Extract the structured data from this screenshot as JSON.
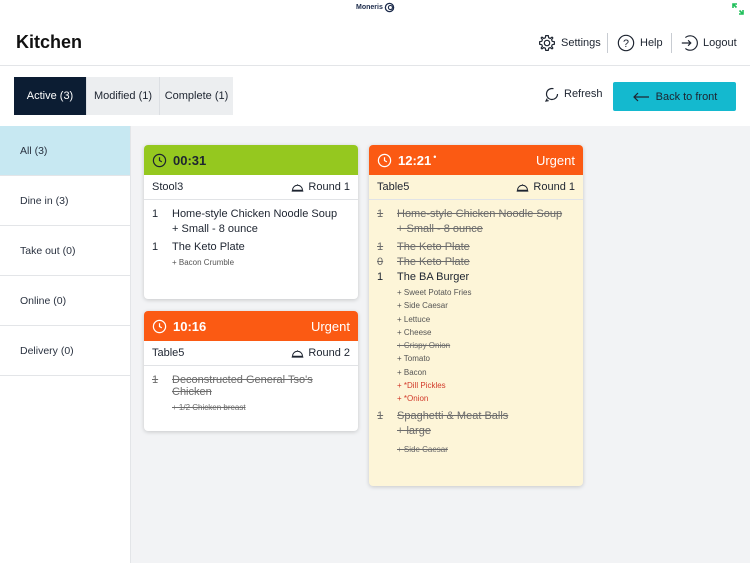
{
  "statusbar": {
    "brand": "Moneris"
  },
  "header": {
    "title": "Kitchen",
    "settings": "Settings",
    "help": "Help",
    "logout": "Logout"
  },
  "toolbar": {
    "tabs": [
      {
        "label": "Active (3)",
        "active": true
      },
      {
        "label": "Modified (1)",
        "active": false
      },
      {
        "label": "Complete (1)",
        "active": false
      }
    ],
    "refresh": "Refresh",
    "back": "Back to front"
  },
  "sidebar": {
    "items": [
      {
        "label": "All (3)",
        "active": true
      },
      {
        "label": "Dine in (3)"
      },
      {
        "label": "Take out (0)"
      },
      {
        "label": "Online (0)"
      },
      {
        "label": "Delivery (0)"
      }
    ]
  },
  "orders": [
    {
      "time": "00:31",
      "color": "#95c81f",
      "table": "Stool3",
      "round": "Round 1",
      "items": [
        {
          "qty": "1",
          "name": "Home-style Chicken Noodle Soup",
          "big_mod": "+ Small - 8 ounce"
        },
        {
          "qty": "1",
          "name": "The Keto Plate",
          "mods": [
            "+ Bacon Crumble"
          ]
        }
      ]
    },
    {
      "time": "10:16",
      "color": "#fb5a13",
      "urgent": "Urgent",
      "table": "Table5",
      "round": "Round 2",
      "items": [
        {
          "qty": "1",
          "name": "Deconstructed General Tso's Chicken",
          "mods": [
            "+ 1/2 Chicken breast"
          ],
          "struck": true
        }
      ]
    },
    {
      "time": "12:21",
      "dot": "•",
      "color": "#fb5a13",
      "urgent": "Urgent",
      "table": "Table5",
      "round": "Round 1",
      "items": [
        {
          "qty": "1",
          "name": "Home-style Chicken Noodle Soup",
          "big_mod": "+ Small - 8 ounce",
          "struck": true
        },
        {
          "qty": "1",
          "name": "The Keto Plate",
          "struck": true
        },
        {
          "qty": "0",
          "name": "The Keto Plate",
          "struck": true
        },
        {
          "qty": "1",
          "name": "The BA Burger",
          "mods": [
            "+ Sweet Potato Fries",
            "+ Side Caesar",
            "+ Lettuce",
            "+ Cheese",
            "+ Crispy Onion",
            "+ Tomato",
            "+ Bacon",
            "+ *Dill Pickles",
            "+ *Onion"
          ]
        },
        {
          "qty": "1",
          "name": "Spaghetti & Meat Balls",
          "big_mod": "+ large",
          "mods": [
            "+ Side Caesar"
          ],
          "struck": true
        }
      ]
    }
  ]
}
